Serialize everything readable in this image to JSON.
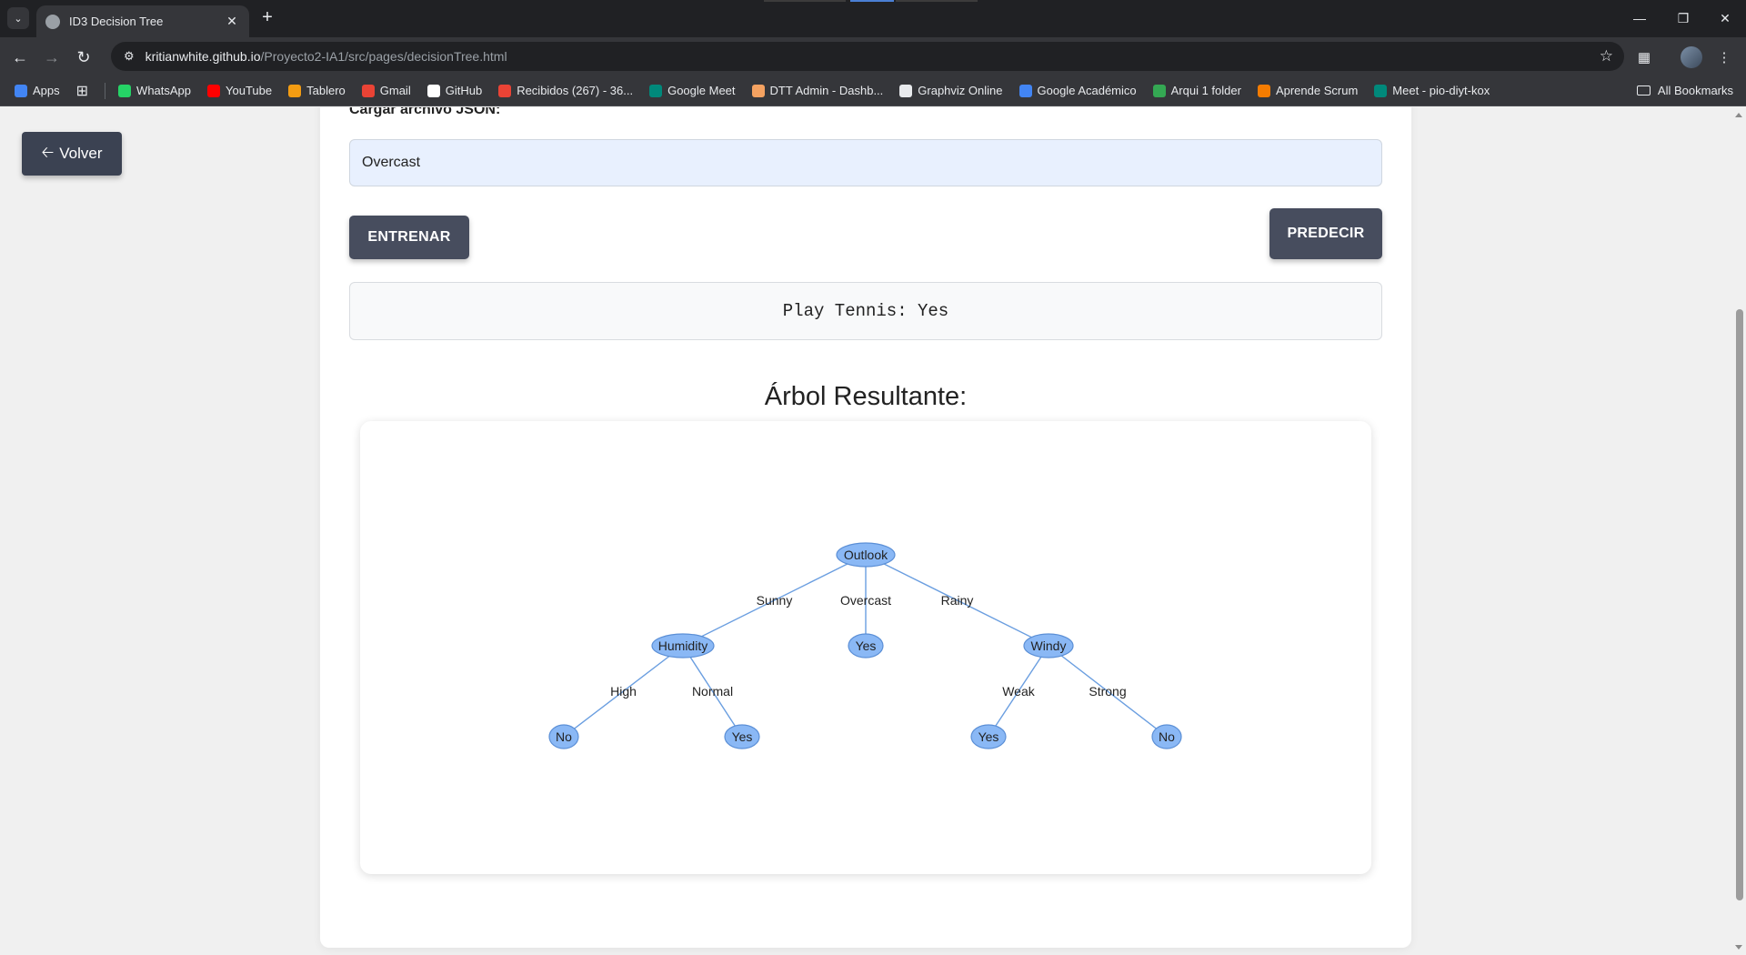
{
  "browser": {
    "tab_title": "ID3 Decision Tree",
    "url_host": "kritianwhite.github.io",
    "url_path": "/Proyecto2-IA1/src/pages/decisionTree.html",
    "bookmarks": [
      {
        "label": "Apps",
        "icon": "apps-grid-icon",
        "color": "#4285f4"
      },
      {
        "label": "WhatsApp",
        "icon": "whatsapp-icon",
        "color": "#25d366"
      },
      {
        "label": "YouTube",
        "icon": "youtube-icon",
        "color": "#ff0000"
      },
      {
        "label": "Tablero",
        "icon": "tablero-icon",
        "color": "#f39c12"
      },
      {
        "label": "Gmail",
        "icon": "gmail-icon",
        "color": "#ea4335"
      },
      {
        "label": "GitHub",
        "icon": "github-icon",
        "color": "#ffffff"
      },
      {
        "label": "Recibidos (267) - 36...",
        "icon": "gmail-icon",
        "color": "#ea4335"
      },
      {
        "label": "Google Meet",
        "icon": "google-meet-icon",
        "color": "#00897b"
      },
      {
        "label": "DTT Admin - Dashb...",
        "icon": "dtt-admin-icon",
        "color": "#f4a261"
      },
      {
        "label": "Graphviz Online",
        "icon": "graphviz-icon",
        "color": "#e8eaed"
      },
      {
        "label": "Google Académico",
        "icon": "google-scholar-icon",
        "color": "#4285f4"
      },
      {
        "label": "Arqui 1 folder",
        "icon": "google-drive-icon",
        "color": "#34a853"
      },
      {
        "label": "Aprende Scrum",
        "icon": "scrum-icon",
        "color": "#f57c00"
      },
      {
        "label": "Meet - pio-diyt-kox",
        "icon": "google-meet-icon",
        "color": "#00897b"
      }
    ],
    "all_bookmarks": "All Bookmarks"
  },
  "page": {
    "back_label": "Volver",
    "load_label": "Cargar archivo JSON:",
    "json_value": "Overcast",
    "train_label": "ENTRENAR",
    "predict_label": "PREDECIR",
    "result": "Play Tennis: Yes",
    "tree_title": "Árbol Resultante:"
  },
  "tree": {
    "node_fill": "#8ab8f5",
    "node_stroke": "#5b8fd6",
    "edge_color": "#6a9ee0",
    "nodes": [
      {
        "id": "outlook",
        "label": "Outlook"
      },
      {
        "id": "humidity",
        "label": "Humidity"
      },
      {
        "id": "yes1",
        "label": "Yes"
      },
      {
        "id": "windy",
        "label": "Windy"
      },
      {
        "id": "no1",
        "label": "No"
      },
      {
        "id": "yes2",
        "label": "Yes"
      },
      {
        "id": "yes3",
        "label": "Yes"
      },
      {
        "id": "no2",
        "label": "No"
      }
    ],
    "edges": [
      {
        "from": "outlook",
        "to": "humidity",
        "label": "Sunny"
      },
      {
        "from": "outlook",
        "to": "yes1",
        "label": "Overcast"
      },
      {
        "from": "outlook",
        "to": "windy",
        "label": "Rainy"
      },
      {
        "from": "humidity",
        "to": "no1",
        "label": "High"
      },
      {
        "from": "humidity",
        "to": "yes2",
        "label": "Normal"
      },
      {
        "from": "windy",
        "to": "yes3",
        "label": "Weak"
      },
      {
        "from": "windy",
        "to": "no2",
        "label": "Strong"
      }
    ]
  }
}
